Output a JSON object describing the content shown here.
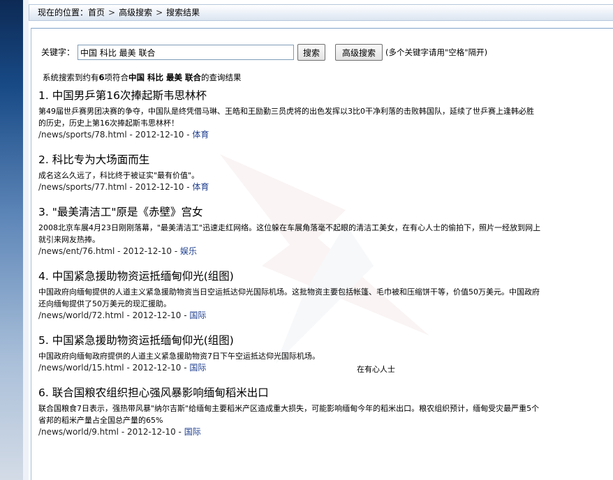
{
  "breadcrumb": {
    "prefix": "现在的位置：",
    "items": [
      "首页",
      "高级搜索",
      "搜索结果"
    ],
    "separator": ">"
  },
  "search": {
    "label": "关键字：",
    "value": "中国 科比 最美 联合",
    "search_button": "搜索",
    "advanced_button": "高级搜索",
    "hint": "(多个关键字请用\"空格\"隔开)"
  },
  "summary": {
    "before": "系统搜索到约有",
    "count": "6",
    "middle": "项符合",
    "keywords": "中国 科比 最美 联合",
    "after": "的查询结果"
  },
  "results": [
    {
      "title": "1. 中国男乒第16次捧起斯韦思林杯",
      "desc": "第49届世乒赛男团决赛的争夺，中国队是终凭借马琳、王皓和王励勤三员虎将的出色发挥以3比0干净利落的击败韩国队，延续了世乒赛上逢韩必胜的历史，历史上第16次捧起斯韦思林杯！",
      "path": "/news/sports/78.html",
      "date": "2012-12-10",
      "category": "体育"
    },
    {
      "title": "2. 科比专为大场面而生",
      "desc": "成名这么久远了，科比终于被证实\"最有价值\"。",
      "path": "/news/sports/77.html",
      "date": "2012-12-10",
      "category": "体育"
    },
    {
      "title": "3. \"最美清洁工\"原是《赤壁》宫女",
      "desc": "2008北京车展4月23日刚刚落幕，\"最美清洁工\"迅速走红网络。这位躲在车展角落毫不起眼的清洁工美女，在有心人士的偷拍下，照片一经放到网上就引来网友热捧。",
      "path": "/news/ent/76.html",
      "date": "2012-12-10",
      "category": "娱乐"
    },
    {
      "title": "4. 中国紧急援助物资运抵缅甸仰光(组图)",
      "desc": "中国政府向缅甸提供的人道主义紧急援助物资当日空运抵达仰光国际机场。这批物资主要包括帐篷、毛巾被和压缩饼干等，价值50万美元。中国政府还向缅甸提供了50万美元的现汇援助。",
      "path": "/news/world/72.html",
      "date": "2012-12-10",
      "category": "国际"
    },
    {
      "title": "5. 中国紧急援助物资运抵缅甸仰光(组图)",
      "desc": "中国政府向缅甸政府提供的人道主义紧急援助物资7日下午空运抵达仰光国际机场。",
      "path": "/news/world/15.html",
      "date": "2012-12-10",
      "category": "国际"
    },
    {
      "title": "6. 联合国粮农组织担心强风暴影响缅甸稻米出口",
      "desc": "联合国粮食7日表示，强热带风暴\"纳尔吉斯\"给缅甸主要稻米产区造成重大损失，可能影响缅甸今年的稻米出口。粮农组织预计，缅甸受灾最严重5个省邦的稻米产量占全国总产量的65%",
      "path": "/news/world/9.html",
      "date": "2012-12-10",
      "category": "国际"
    }
  ],
  "stray_text": "在有心人士",
  "meta_separator": " - "
}
